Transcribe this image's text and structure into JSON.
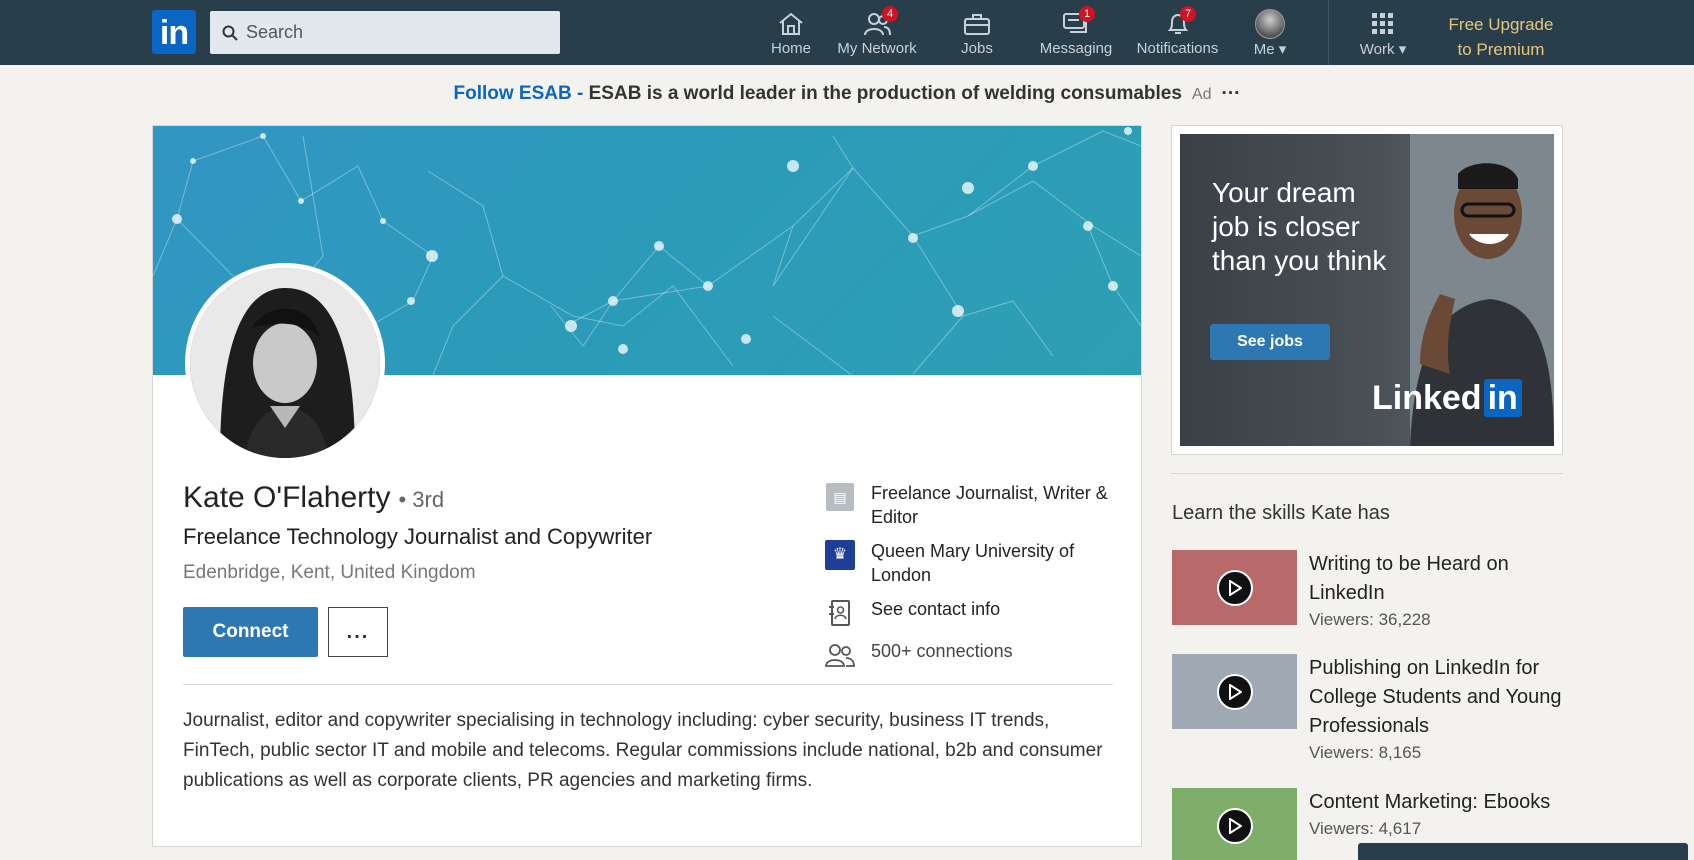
{
  "nav": {
    "logo": "in",
    "search_placeholder": "Search",
    "items": [
      {
        "label": "Home",
        "icon": "home-icon",
        "badge": ""
      },
      {
        "label": "My Network",
        "icon": "network-icon",
        "badge": "4"
      },
      {
        "label": "Jobs",
        "icon": "briefcase-icon",
        "badge": ""
      },
      {
        "label": "Messaging",
        "icon": "messaging-icon",
        "badge": "1"
      },
      {
        "label": "Notifications",
        "icon": "bell-icon",
        "badge": "7"
      },
      {
        "label": "Me",
        "icon": "avatar",
        "badge": ""
      },
      {
        "label": "Work",
        "icon": "grid-icon",
        "badge": ""
      }
    ],
    "premium_line1": "Free Upgrade",
    "premium_line2": "to Premium"
  },
  "adline": {
    "follow": "Follow ESAB",
    "sep": " - ",
    "text": "ESAB is a world leader in the production of welding consumables",
    "tag": "Ad",
    "more": "···"
  },
  "profile": {
    "name": "Kate O'Flaherty",
    "degree": "• 3rd",
    "headline": "Freelance Technology Journalist and Copywriter",
    "location": "Edenbridge, Kent, United Kingdom",
    "connect_label": "Connect",
    "more_label": "...",
    "company": "Freelance Journalist, Writer & Editor",
    "school": "Queen Mary University of London",
    "contact": "See contact info",
    "connections": "500+ connections",
    "summary": "Journalist, editor and copywriter specialising in technology including: cyber security, business IT trends, FinTech, public sector IT and mobile and telecoms. Regular commissions include national, b2b and consumer publications as well as corporate clients, PR agencies and marketing firms."
  },
  "ad": {
    "text": "Your dream job is closer than you think",
    "button": "See jobs",
    "brand": "Linked",
    "brand_in": "in"
  },
  "learning": {
    "title": "Learn the skills Kate has",
    "courses": [
      {
        "title": "Writing to be Heard on LinkedIn",
        "viewers": "Viewers: 36,228",
        "color": "#b86a6a"
      },
      {
        "title": "Publishing on LinkedIn for College Students and Young Professionals",
        "viewers": "Viewers: 8,165",
        "color": "#9fa9b3"
      },
      {
        "title": "Content Marketing: Ebooks",
        "viewers": "Viewers: 4,617",
        "color": "#7fae6a"
      }
    ]
  },
  "colors": {
    "nav_bg": "#283e4a",
    "brand": "#0a66c2",
    "premium": "#e7c67b",
    "badge": "#d11124"
  }
}
